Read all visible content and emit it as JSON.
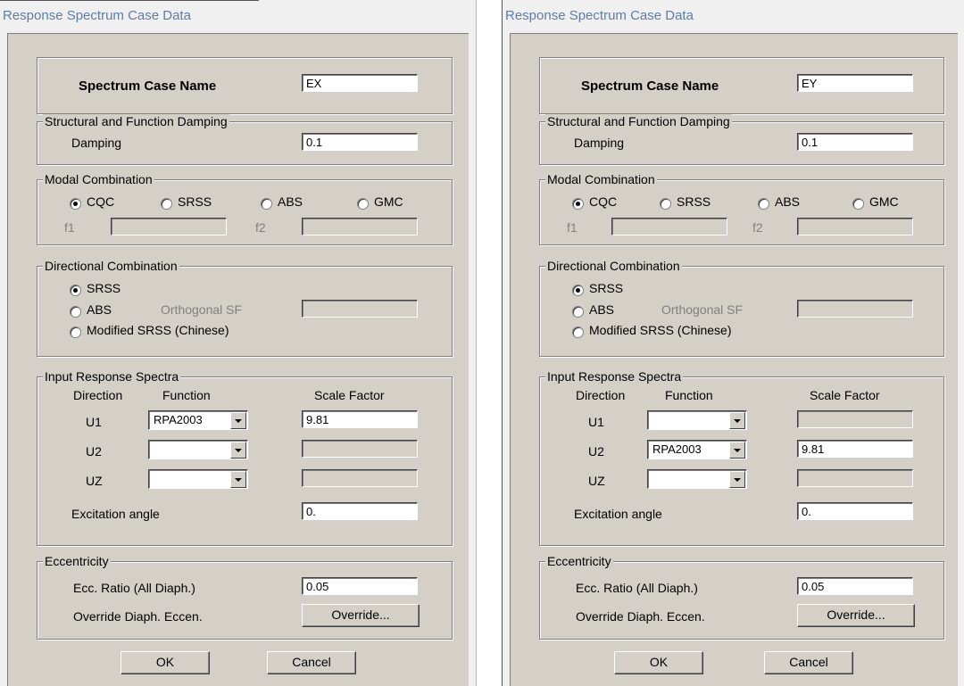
{
  "dialogs": [
    {
      "title": "Response Spectrum Case Data",
      "case_name_label": "Spectrum Case Name",
      "case_name": "EX",
      "damping_group": "Structural and Function Damping",
      "damping_label": "Damping",
      "damping": "0.1",
      "modal_group": "Modal Combination",
      "modal_options": [
        "CQC",
        "SRSS",
        "ABS",
        "GMC"
      ],
      "modal_selected": "CQC",
      "f1_label": "f1",
      "f2_label": "f2",
      "directional_group": "Directional Combination",
      "dir_srss": "SRSS",
      "dir_abs": "ABS",
      "orthogonal_label": "Orthogonal SF",
      "dir_modified": "Modified SRSS (Chinese)",
      "directional_selected": "SRSS",
      "input_group": "Input Response Spectra",
      "col_direction": "Direction",
      "col_function": "Function",
      "col_scale": "Scale Factor",
      "rows": [
        {
          "direction": "U1",
          "function": "RPA2003",
          "scale": "9.81"
        },
        {
          "direction": "U2",
          "function": "",
          "scale": ""
        },
        {
          "direction": "UZ",
          "function": "",
          "scale": ""
        }
      ],
      "excitation_label": "Excitation  angle",
      "excitation": "0.",
      "ecc_group": "Eccentricity",
      "ecc_ratio_label": "Ecc. Ratio (All Diaph.)",
      "ecc_ratio": "0.05",
      "override_label": "Override Diaph. Eccen.",
      "override_button": "Override...",
      "ok": "OK",
      "cancel": "Cancel"
    },
    {
      "title": "Response Spectrum Case Data",
      "case_name_label": "Spectrum Case Name",
      "case_name": "EY",
      "damping_group": "Structural and Function Damping",
      "damping_label": "Damping",
      "damping": "0.1",
      "modal_group": "Modal Combination",
      "modal_options": [
        "CQC",
        "SRSS",
        "ABS",
        "GMC"
      ],
      "modal_selected": "CQC",
      "f1_label": "f1",
      "f2_label": "f2",
      "directional_group": "Directional Combination",
      "dir_srss": "SRSS",
      "dir_abs": "ABS",
      "orthogonal_label": "Orthogonal SF",
      "dir_modified": "Modified SRSS (Chinese)",
      "directional_selected": "SRSS",
      "input_group": "Input Response Spectra",
      "col_direction": "Direction",
      "col_function": "Function",
      "col_scale": "Scale Factor",
      "rows": [
        {
          "direction": "U1",
          "function": "",
          "scale": ""
        },
        {
          "direction": "U2",
          "function": "RPA2003",
          "scale": "9.81"
        },
        {
          "direction": "UZ",
          "function": "",
          "scale": ""
        }
      ],
      "excitation_label": "Excitation  angle",
      "excitation": "0.",
      "ecc_group": "Eccentricity",
      "ecc_ratio_label": "Ecc. Ratio (All Diaph.)",
      "ecc_ratio": "0.05",
      "override_label": "Override Diaph. Eccen.",
      "override_button": "Override...",
      "ok": "OK",
      "cancel": "Cancel"
    }
  ]
}
